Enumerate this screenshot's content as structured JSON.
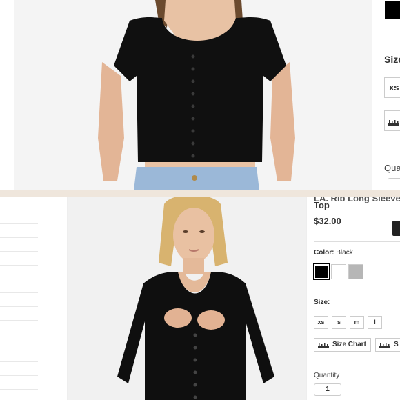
{
  "top_panel": {
    "size_label": "Size",
    "size_option": "xs",
    "quantity_label": "Qua",
    "swatch_color": "#000000"
  },
  "product": {
    "title_cut": "LA. Rib Long Sleeve",
    "title": "Top",
    "price": "$32.00",
    "color_label": "Color:",
    "color_value": "Black",
    "swatches": [
      {
        "name": "Black",
        "hex": "#000000",
        "selected": true
      },
      {
        "name": "White",
        "hex": "#ffffff",
        "selected": false
      },
      {
        "name": "Grey",
        "hex": "#b6b6b6",
        "selected": false
      }
    ],
    "size_label": "Size:",
    "sizes": [
      "xs",
      "s",
      "m",
      "l"
    ],
    "size_chart_label": "Size Chart",
    "size_chart_label_cut": "S",
    "quantity_label": "Quantity",
    "quantity_value": "1"
  },
  "icons": {
    "ruler": "ruler-icon",
    "share": "share-icon"
  }
}
